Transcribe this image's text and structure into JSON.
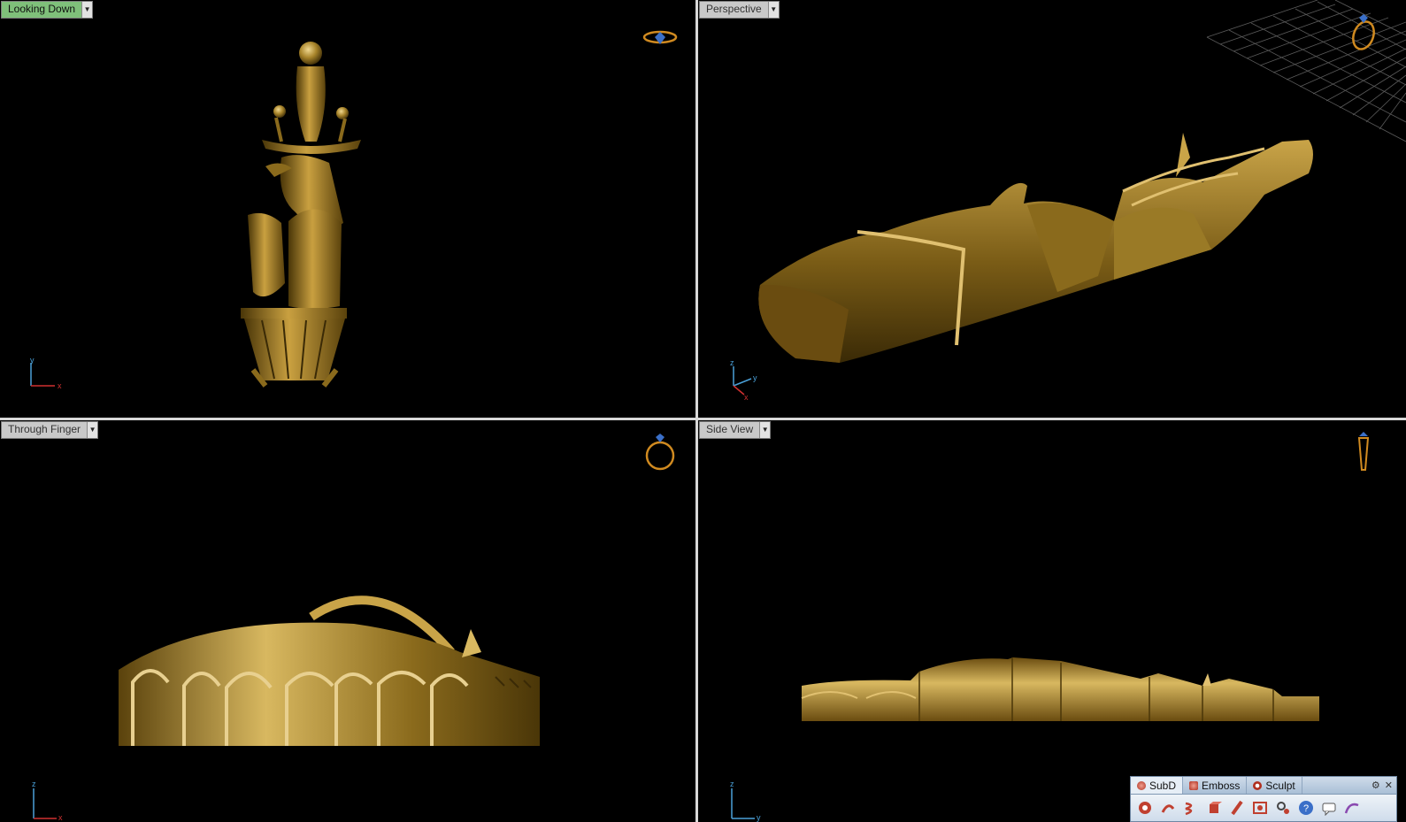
{
  "viewports": [
    {
      "title": "Looking Down",
      "active": true,
      "axis": {
        "a": "y",
        "b": "x"
      }
    },
    {
      "title": "Perspective",
      "active": false,
      "axis": {
        "a": "z",
        "b": "y",
        "c": "x"
      }
    },
    {
      "title": "Through Finger",
      "active": false,
      "axis": {
        "a": "z",
        "b": "x"
      }
    },
    {
      "title": "Side View",
      "active": false,
      "axis": {
        "a": "z",
        "b": "y"
      }
    }
  ],
  "toolbar": {
    "tabs": [
      {
        "label": "SubD",
        "icon": "subd-icon",
        "color": "#c0392b"
      },
      {
        "label": "Emboss",
        "icon": "emboss-icon",
        "color": "#c0392b"
      },
      {
        "label": "Sculpt",
        "icon": "sculpt-icon",
        "color": "#c0392b"
      }
    ],
    "tools": [
      "subd-sphere-icon",
      "subd-bend-icon",
      "subd-twist-icon",
      "subd-box-icon",
      "subd-pipe-icon",
      "subd-convert-icon",
      "subd-settings-icon",
      "help-icon",
      "comment-icon",
      "curve-tool-icon"
    ]
  },
  "colors": {
    "gold": "#a8842a",
    "gold_dark": "#4a3608",
    "gold_light": "#e0c070",
    "active_tab": "#7fc07a"
  }
}
